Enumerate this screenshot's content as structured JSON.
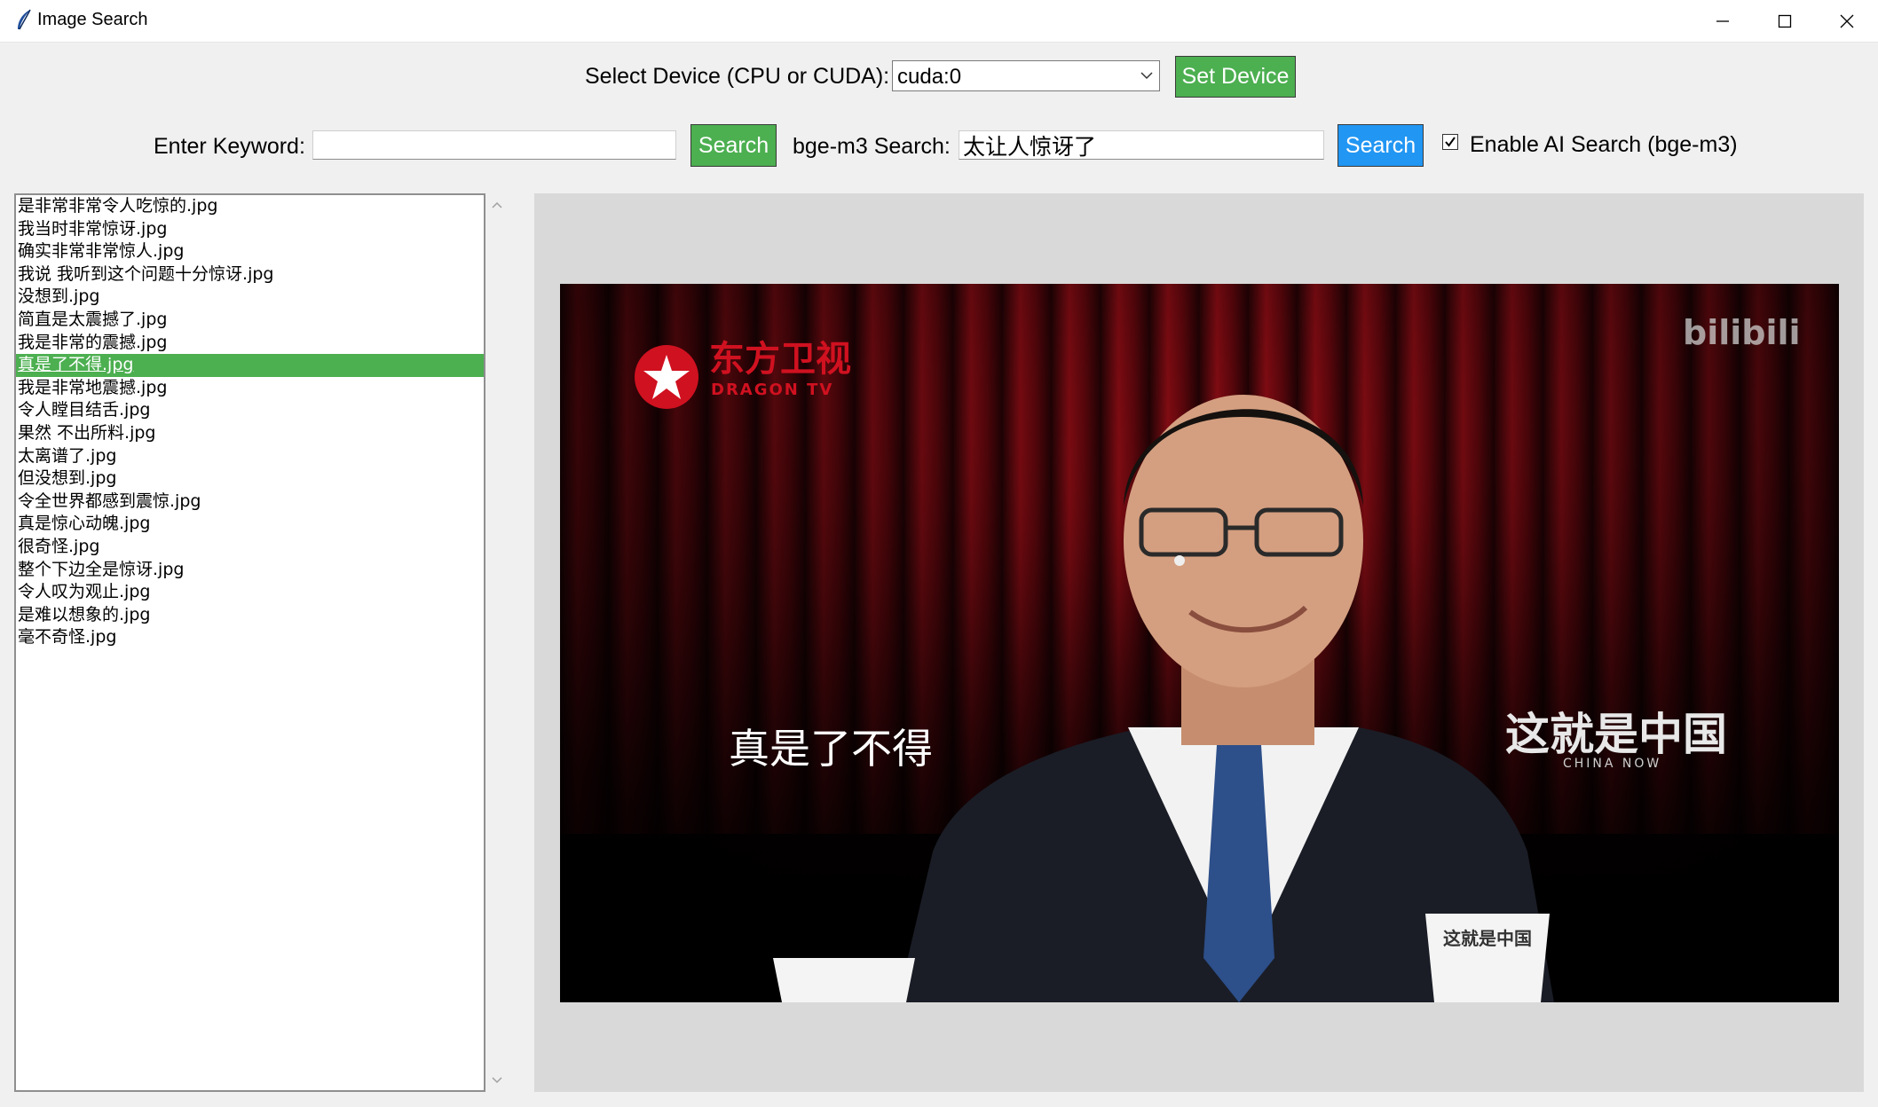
{
  "window": {
    "title": "Image Search",
    "controls": [
      "minimize-icon",
      "maximize-icon",
      "close-icon"
    ]
  },
  "device": {
    "label": "Select Device (CPU or CUDA):",
    "selected": "cuda:0",
    "button": "Set Device"
  },
  "keyword": {
    "label": "Enter Keyword:",
    "value": "",
    "button": "Search"
  },
  "ai_search": {
    "label": "bge-m3 Search:",
    "value": "太让人惊讶了",
    "button": "Search",
    "checkbox_label": "Enable AI Search (bge-m3)",
    "checked": true
  },
  "files": [
    "是非常非常令人吃惊的.jpg",
    "我当时非常惊讶.jpg",
    "确实非常非常惊人.jpg",
    "我说 我听到这个问题十分惊讶.jpg",
    "没想到.jpg",
    "简直是太震撼了.jpg",
    "我是非常的震撼.jpg",
    "真是了不得.jpg",
    "我是非常地震撼.jpg",
    "令人瞠目结舌.jpg",
    "果然  不出所料.jpg",
    "太离谱了.jpg",
    "但没想到.jpg",
    "令全世界都感到震惊.jpg",
    "真是惊心动魄.jpg",
    "很奇怪.jpg",
    "整个下边全是惊讶.jpg",
    "令人叹为观止.jpg",
    "是难以想象的.jpg",
    "毫不奇怪.jpg"
  ],
  "selected_index": 7,
  "preview": {
    "channel_logo": "东方卫视",
    "channel_logo_en": "DRAGON TV",
    "watermark": "bilibili",
    "show_title": "这就是中国",
    "show_title_en": "CHINA NOW",
    "subtitle": "真是了不得",
    "mug_text": "这就是中国"
  },
  "colors": {
    "green_button": "#4caf50",
    "blue_button": "#2196f3",
    "selection": "#4caf50"
  }
}
